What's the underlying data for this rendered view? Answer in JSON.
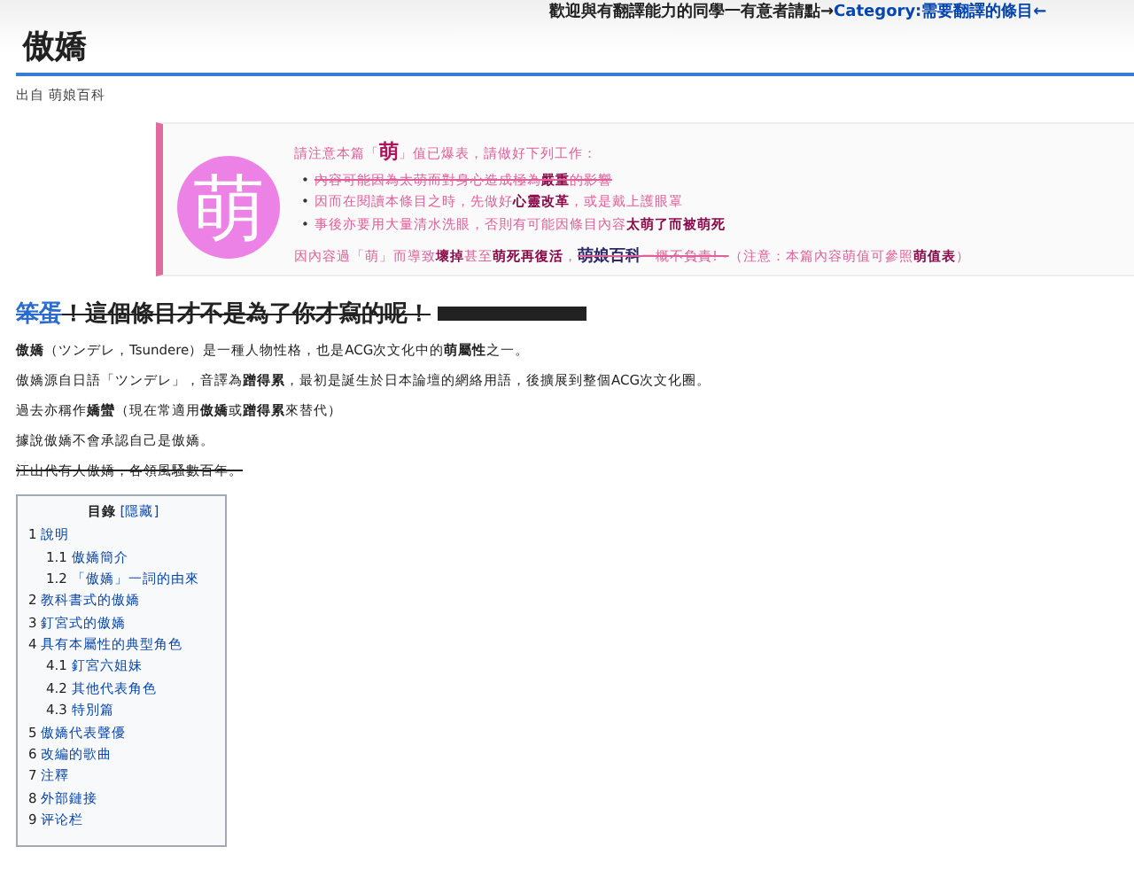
{
  "site_notice": {
    "text": "歡迎與有翻譯能力的同學一有意者請點→",
    "link": "Category:需要翻譯的條目←"
  },
  "title": "傲嬌",
  "subtitle": "出自 萌娘百科",
  "notice": {
    "logo_text": "萌",
    "bullet": "•",
    "heading": "請注意本篇「**萌**」值已爆表，請做好下列工作：",
    "items": [
      {
        "text": "內容可能因為太萌而對身心造成極為**嚴重**的影響",
        "struck": true
      },
      {
        "text": "因而在閱讀本條目之時，先做好**心靈改革**，或是戴上護眼罩",
        "struck": false
      },
      {
        "text": "事後亦要用大量清水洗眼，否則有可能因條目內容**太萌了而被萌死**",
        "struck": false
      }
    ],
    "footer": [
      {
        "text": "因內容過「萌」而導致**壞掉**甚至**萌死再復活**，",
        "struck": false
      },
      {
        "text": "**萌娘百科**一概不負責!~",
        "struck": true
      },
      {
        "text": "（注意：本篇內容萌值可參照**萌值表**）",
        "struck": false
      }
    ]
  },
  "heading": [
    {
      "text": "笨蛋",
      "kind": "link"
    },
    {
      "text": "！這個條目才不是為了你才寫的呢！",
      "kind": "plain"
    }
  ],
  "heading_struck": true,
  "paragraphs": [
    {
      "text": "**傲嬌**（ツンデレ，Tsundere）是一種人物性格，也是ACG次文化中的**萌屬性**之一。",
      "struck": false
    },
    {
      "text": "傲嬌源自日語「ツンデレ」，音譯為**蹭得累**，最初是誕生於日本論壇的網絡用語，後擴展到整個ACG次文化圈。",
      "struck": false
    },
    {
      "text": "過去亦稱作**嬌蠻**（現在常適用**傲嬌**或**蹭得累**來替代）",
      "struck": false
    },
    {
      "text": "據說傲嬌不會承認自己是傲嬌。",
      "struck": false
    },
    {
      "text": "江山代有人傲嬌，各領風騷數百年。",
      "struck": true
    }
  ],
  "toc": {
    "title": "目錄",
    "toggle": "[隱藏]",
    "items": [
      {
        "number": "1",
        "text": "說明",
        "children": [
          {
            "number": "1.1",
            "text": "傲嬌簡介"
          },
          {
            "number": "1.2",
            "text": "「傲嬌」一詞的由來"
          }
        ]
      },
      {
        "number": "2",
        "text": "教科書式的傲嬌"
      },
      {
        "number": "3",
        "text": "釘宮式的傲嬌"
      },
      {
        "number": "4",
        "text": "具有本屬性的典型角色",
        "children": [
          {
            "number": "4.1",
            "text": "釘宮六姐妹"
          },
          {
            "number": "4.2",
            "text": "其他代表角色"
          },
          {
            "number": "4.3",
            "text": "特別篇"
          }
        ]
      },
      {
        "number": "5",
        "text": "傲嬌代表聲優"
      },
      {
        "number": "6",
        "text": "改編的歌曲"
      },
      {
        "number": "7",
        "text": "注釋"
      },
      {
        "number": "8",
        "text": "外部鏈接"
      },
      {
        "number": "9",
        "text": "评论栏"
      }
    ]
  }
}
